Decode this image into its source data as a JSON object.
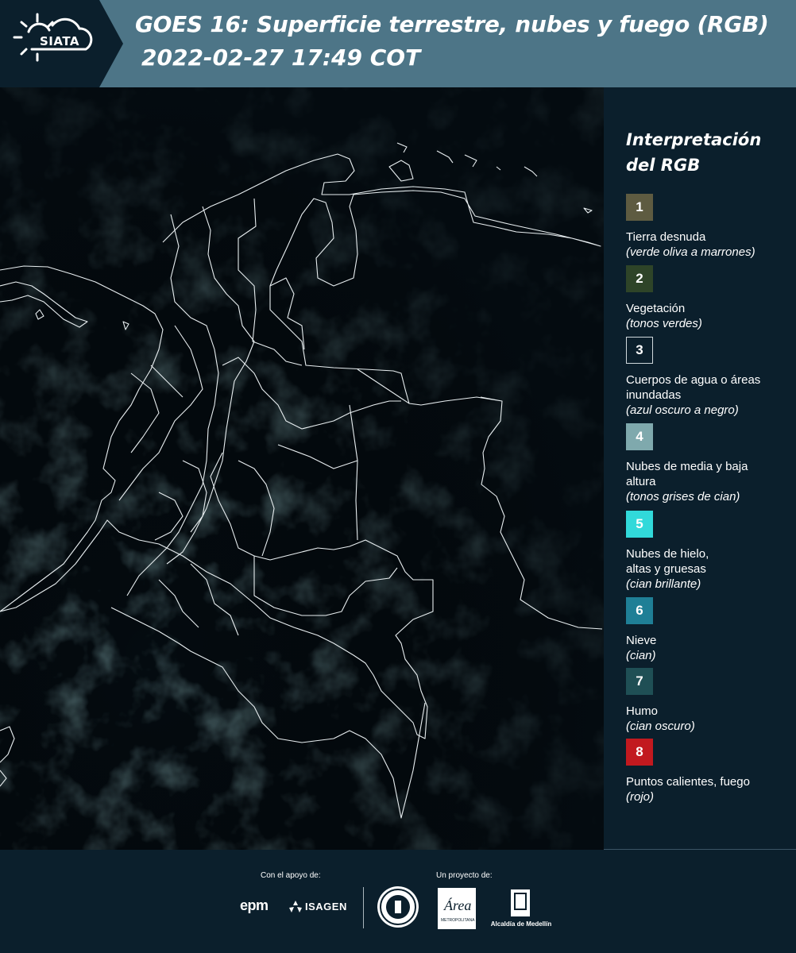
{
  "header": {
    "logo_text": "SIATA",
    "title": "GOES 16: Superficie terrestre, nubes y fuego (RGB)",
    "datetime": "2022-02-27 17:49 COT"
  },
  "legend": {
    "title": "Interpretación del RGB",
    "items": [
      {
        "number": "1",
        "name": "Tierra desnuda",
        "desc": "(verde oliva a marrones)",
        "color": "#5e5b41"
      },
      {
        "number": "2",
        "name": "Vegetación",
        "desc": "(tonos verdes)",
        "color": "#2e4428"
      },
      {
        "number": "3",
        "name": "Cuerpos de agua o áreas inundadas",
        "desc": "(azul oscuro a negro)",
        "color": "#0b1f2c"
      },
      {
        "number": "4",
        "name": "Nubes de media y baja altura",
        "desc": "(tonos grises de cian)",
        "color": "#7fa9ad"
      },
      {
        "number": "5",
        "name": "Nubes de hielo, altas y gruesas",
        "desc": "(cian brillante)",
        "color": "#31d9da"
      },
      {
        "number": "6",
        "name": "Nieve",
        "desc": "(cian)",
        "color": "#1f7f96"
      },
      {
        "number": "7",
        "name": "Humo",
        "desc": "(cian oscuro)",
        "color": "#1f4f55"
      },
      {
        "number": "8",
        "name": "Puntos calientes, fuego",
        "desc": "(rojo)",
        "color": "#c2191f"
      }
    ]
  },
  "footer": {
    "support_label": "Con el apoyo de:",
    "project_label": "Un proyecto de:",
    "epm": "epm",
    "isagen": "ISAGEN",
    "area_text": "Área",
    "area_sub": "METROPOLITANA",
    "alcaldia": "Alcaldía de Medellín"
  },
  "colors": {
    "header_bg": "#4d7587",
    "logo_band": "#0b1f2c",
    "page_bg": "#0b1f2c",
    "map_bg": "#040b10",
    "boundary": "#e8eef0"
  }
}
